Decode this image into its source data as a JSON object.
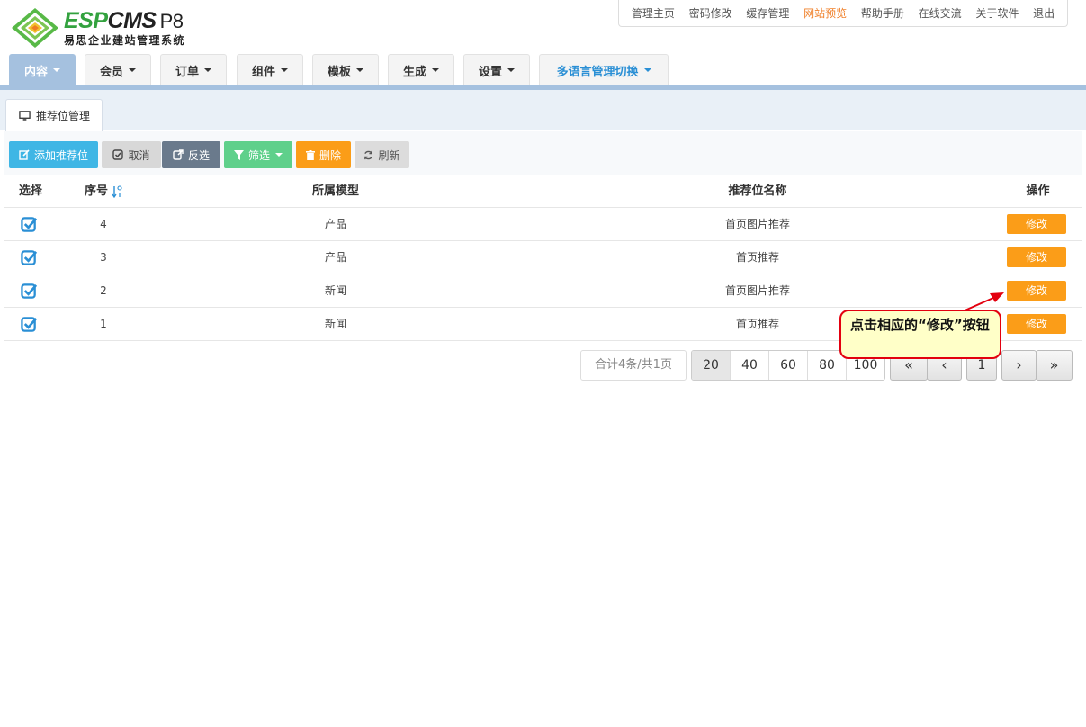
{
  "brand": {
    "name_esp": "ESP",
    "name_cms": "CMS",
    "version": "P8",
    "subtitle": "易思企业建站管理系统"
  },
  "topnav": [
    {
      "label": "管理主页"
    },
    {
      "label": "密码修改"
    },
    {
      "label": "缓存管理"
    },
    {
      "label": "网站预览",
      "highlight": true
    },
    {
      "label": "帮助手册"
    },
    {
      "label": "在线交流"
    },
    {
      "label": "关于软件"
    },
    {
      "label": "退出"
    }
  ],
  "mainnav": [
    {
      "label": "内容",
      "active": true
    },
    {
      "label": "会员"
    },
    {
      "label": "订单"
    },
    {
      "label": "组件"
    },
    {
      "label": "模板"
    },
    {
      "label": "生成"
    },
    {
      "label": "设置"
    },
    {
      "label": "多语言管理切换"
    }
  ],
  "subtab": {
    "label": "推荐位管理",
    "icon": "monitor-icon"
  },
  "toolbar": {
    "add": "添加推荐位",
    "cancel": "取消",
    "invert": "反选",
    "filter": "筛选",
    "delete": "删除",
    "refresh": "刷新"
  },
  "table": {
    "headers": {
      "select": "选择",
      "no": "序号",
      "model": "所属模型",
      "name": "推荐位名称",
      "op": "操作"
    },
    "rows": [
      {
        "no": "4",
        "model": "产品",
        "name": "首页图片推荐",
        "action": "修改",
        "checked": true
      },
      {
        "no": "3",
        "model": "产品",
        "name": "首页推荐",
        "action": "修改",
        "checked": true
      },
      {
        "no": "2",
        "model": "新闻",
        "name": "首页图片推荐",
        "action": "修改",
        "checked": true
      },
      {
        "no": "1",
        "model": "新闻",
        "name": "首页推荐",
        "action": "修改",
        "checked": true
      }
    ]
  },
  "pager": {
    "info": "合计4条/共1页",
    "sizes": [
      "20",
      "40",
      "60",
      "80",
      "100"
    ],
    "selected_size": "20",
    "first": "«",
    "prev": "‹",
    "current": "1",
    "next": "›",
    "last": "»"
  },
  "callout": {
    "text": "点击相应的“修改”按钮"
  },
  "colors": {
    "accent_blue": "#a5c1df",
    "cyan": "#3fb6e5",
    "orange": "#fb9d18",
    "green": "#5fd08b",
    "slate": "#6a7a8c",
    "callout_border": "#e3000f",
    "callout_fill": "#ffffc8"
  }
}
